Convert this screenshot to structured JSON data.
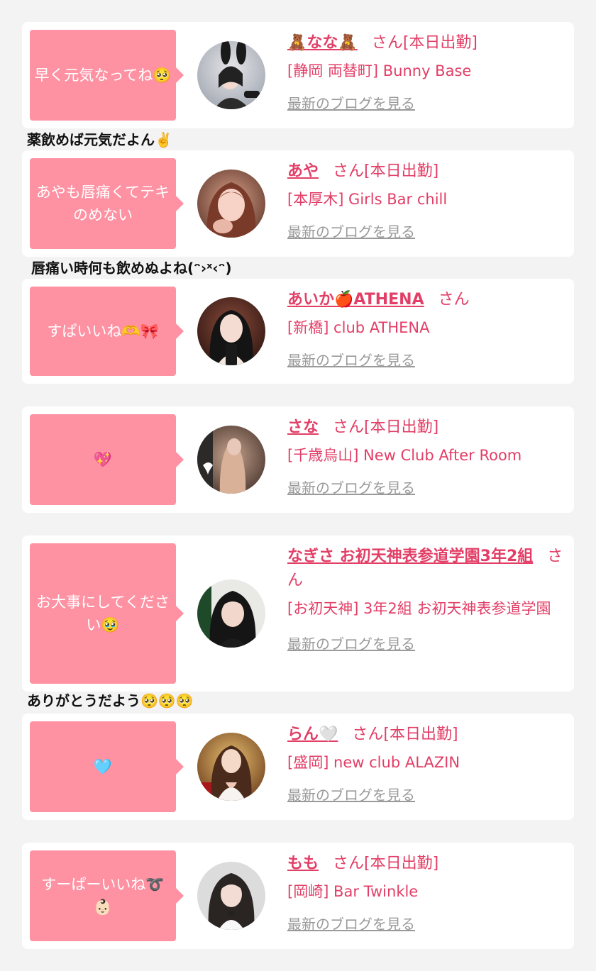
{
  "cards": [
    {
      "message": "早く元気なってね🥺",
      "name": "🧸なな🧸",
      "san": "さん",
      "status": "[本日出勤]",
      "shop": "[静岡 両替町] Bunny Base",
      "blog": "最新のブログを見る",
      "reply": "薬飲めば元気だよん✌️"
    },
    {
      "message": "あやも唇痛くてテキのめない",
      "name": "あや",
      "san": "さん",
      "status": "[本日出勤]",
      "shop": "[本厚木] Girls Bar chill",
      "blog": "最新のブログを見る",
      "reply": "唇痛い時何も飲めぬよね(ᵔ›ˣ‹ᵔ)"
    },
    {
      "message": "すぱいいね🫶🎀",
      "name": "あいか🍎ATHENA",
      "san": "さん",
      "status": "",
      "shop": "[新橋] club ATHENA",
      "blog": "最新のブログを見る",
      "reply": ""
    },
    {
      "message": "💖",
      "name": "さな",
      "san": "さん",
      "status": "[本日出勤]",
      "shop": "[千歳烏山] New Club After Room",
      "blog": "最新のブログを見る",
      "reply": ""
    },
    {
      "message": "お大事にしてください🥹",
      "name": "なぎさ お初天神表参道学園3年2組",
      "san": "さん",
      "status": "",
      "shop": "[お初天神] 3年2組 お初天神表参道学園",
      "blog": "最新のブログを見る",
      "reply": "ありがとうだよう🥺🥺🥺"
    },
    {
      "message": "🩵",
      "name": "らん🤍",
      "san": "さん",
      "status": "[本日出勤]",
      "shop": "[盛岡] new club ALAZIN",
      "blog": "最新のブログを見る",
      "reply": ""
    },
    {
      "message": "すーぱーいいね➰👶🏻",
      "name": "もも",
      "san": "さん",
      "status": "[本日出勤]",
      "shop": "[岡崎] Bar Twinkle",
      "blog": "最新のブログを見る",
      "reply": ""
    }
  ],
  "colors": {
    "background": "#f3f3f3",
    "card": "#ffffff",
    "bubble": "#fe92a3",
    "accent": "#e23e66",
    "blog_link": "#9a9a9a"
  }
}
